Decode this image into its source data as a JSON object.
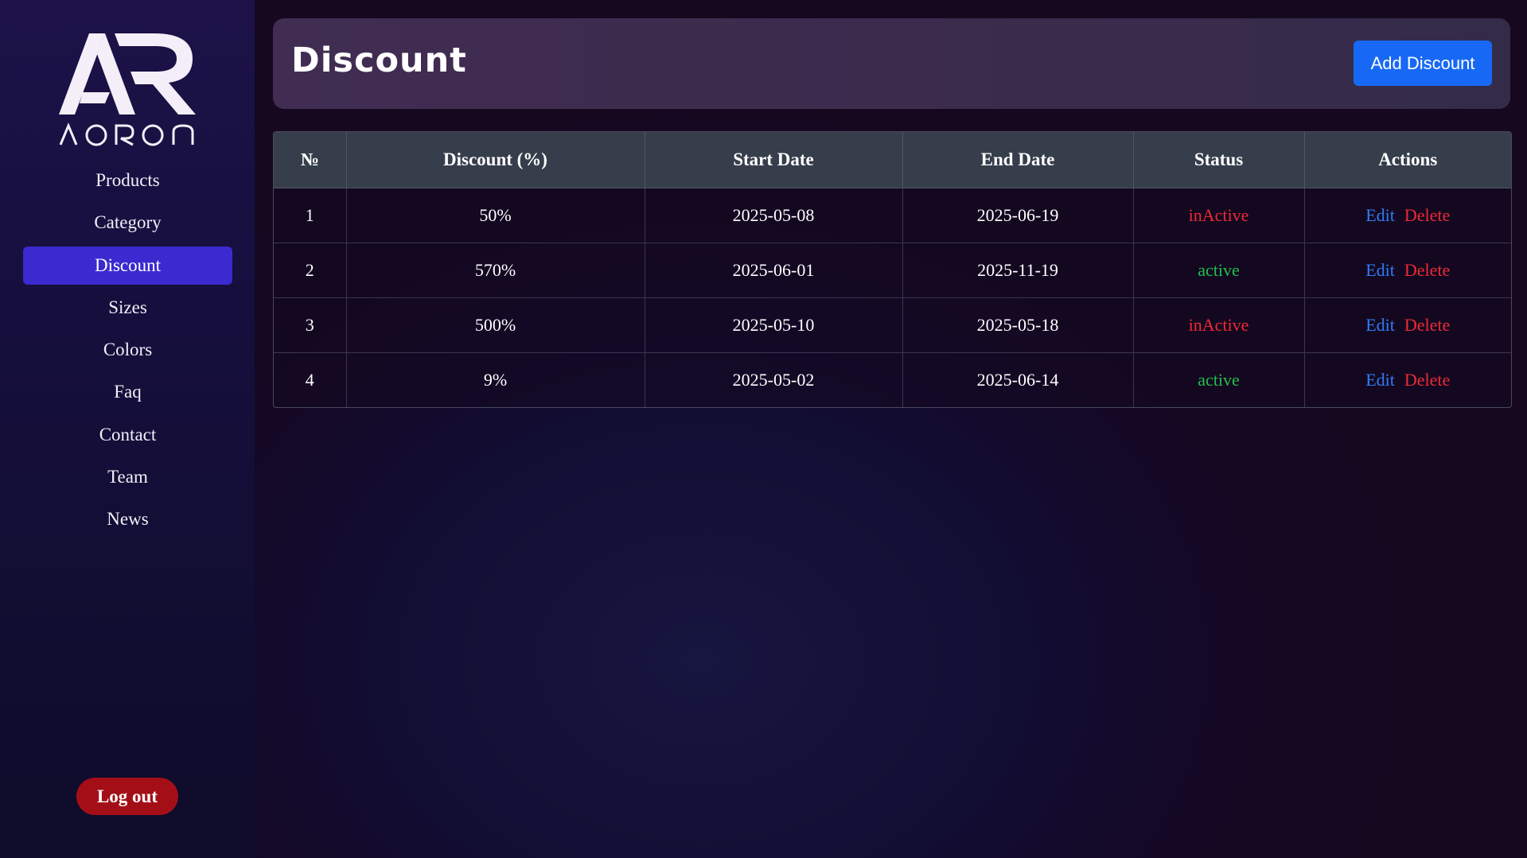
{
  "brand": {
    "name": "AORON"
  },
  "sidebar": {
    "items": [
      {
        "label": "Products",
        "active": false
      },
      {
        "label": "Category",
        "active": false
      },
      {
        "label": "Discount",
        "active": true
      },
      {
        "label": "Sizes",
        "active": false
      },
      {
        "label": "Colors",
        "active": false
      },
      {
        "label": "Faq",
        "active": false
      },
      {
        "label": "Contact",
        "active": false
      },
      {
        "label": "Team",
        "active": false
      },
      {
        "label": "News",
        "active": false
      }
    ],
    "logout_label": "Log out"
  },
  "header": {
    "title": "Discount",
    "add_label": "Add Discount"
  },
  "table": {
    "columns": [
      "№",
      "Discount (%)",
      "Start Date",
      "End Date",
      "Status",
      "Actions"
    ],
    "rows": [
      {
        "num": "1",
        "discount": "50%",
        "start": "2025-05-08",
        "end": "2025-06-19",
        "status": "inActive",
        "edit": "Edit",
        "delete": "Delete"
      },
      {
        "num": "2",
        "discount": "570%",
        "start": "2025-06-01",
        "end": "2025-11-19",
        "status": "active",
        "edit": "Edit",
        "delete": "Delete"
      },
      {
        "num": "3",
        "discount": "500%",
        "start": "2025-05-10",
        "end": "2025-05-18",
        "status": "inActive",
        "edit": "Edit",
        "delete": "Delete"
      },
      {
        "num": "4",
        "discount": "9%",
        "start": "2025-05-02",
        "end": "2025-06-14",
        "status": "active",
        "edit": "Edit",
        "delete": "Delete"
      }
    ]
  },
  "colors": {
    "active_nav": "#3a2ad0",
    "add_button": "#1769f5",
    "logout_button": "#a40f17",
    "status_active": "#1fbf4a",
    "status_inactive": "#ee2a36",
    "edit_link": "#2f7cf6",
    "delete_link": "#ee2a36"
  }
}
